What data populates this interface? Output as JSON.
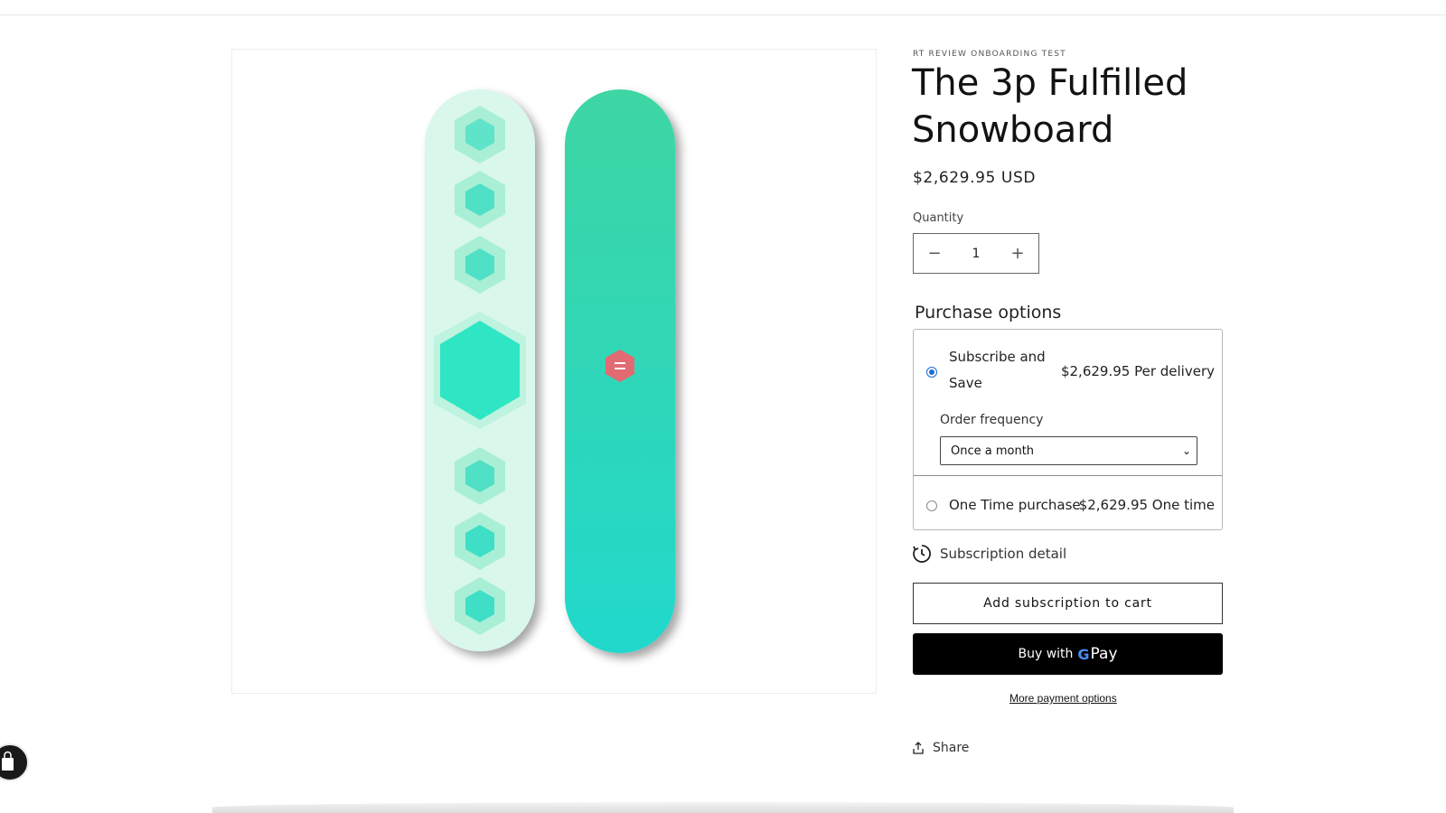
{
  "product": {
    "vendor": "RT REVIEW ONBOARDING TEST",
    "title": "The 3p Fulfilled Snowboard",
    "price": "$2,629.95 USD",
    "image_alt": "Snowboard top and base"
  },
  "quantity": {
    "label": "Quantity",
    "value": "1",
    "decrease_icon": "minus-icon",
    "increase_icon": "plus-icon"
  },
  "purchase_options": {
    "title": "Purchase options",
    "subscribe": {
      "label": "Subscribe and Save",
      "price": "$2,629.95 Per delivery",
      "selected": true
    },
    "frequency": {
      "label": "Order frequency",
      "selected": "Once a month"
    },
    "one_time": {
      "label": "One Time purchase",
      "price": "$2,629.95 One time",
      "selected": false
    }
  },
  "subscription_detail": {
    "label": "Subscription detail",
    "icon": "clock-icon"
  },
  "buttons": {
    "add_subscription": "Add subscription to cart",
    "buy_with": "Buy with",
    "gpay_g": "G",
    "gpay_pay": "Pay",
    "more_payment": "More payment options"
  },
  "share": {
    "label": "Share",
    "icon": "share-icon"
  },
  "colors": {
    "accent_radio": "#1a6fd6",
    "board_base": "#2ed8b8",
    "board_top": "#d9f7ec",
    "logo": "#e06872",
    "buy_button": "#000000"
  }
}
